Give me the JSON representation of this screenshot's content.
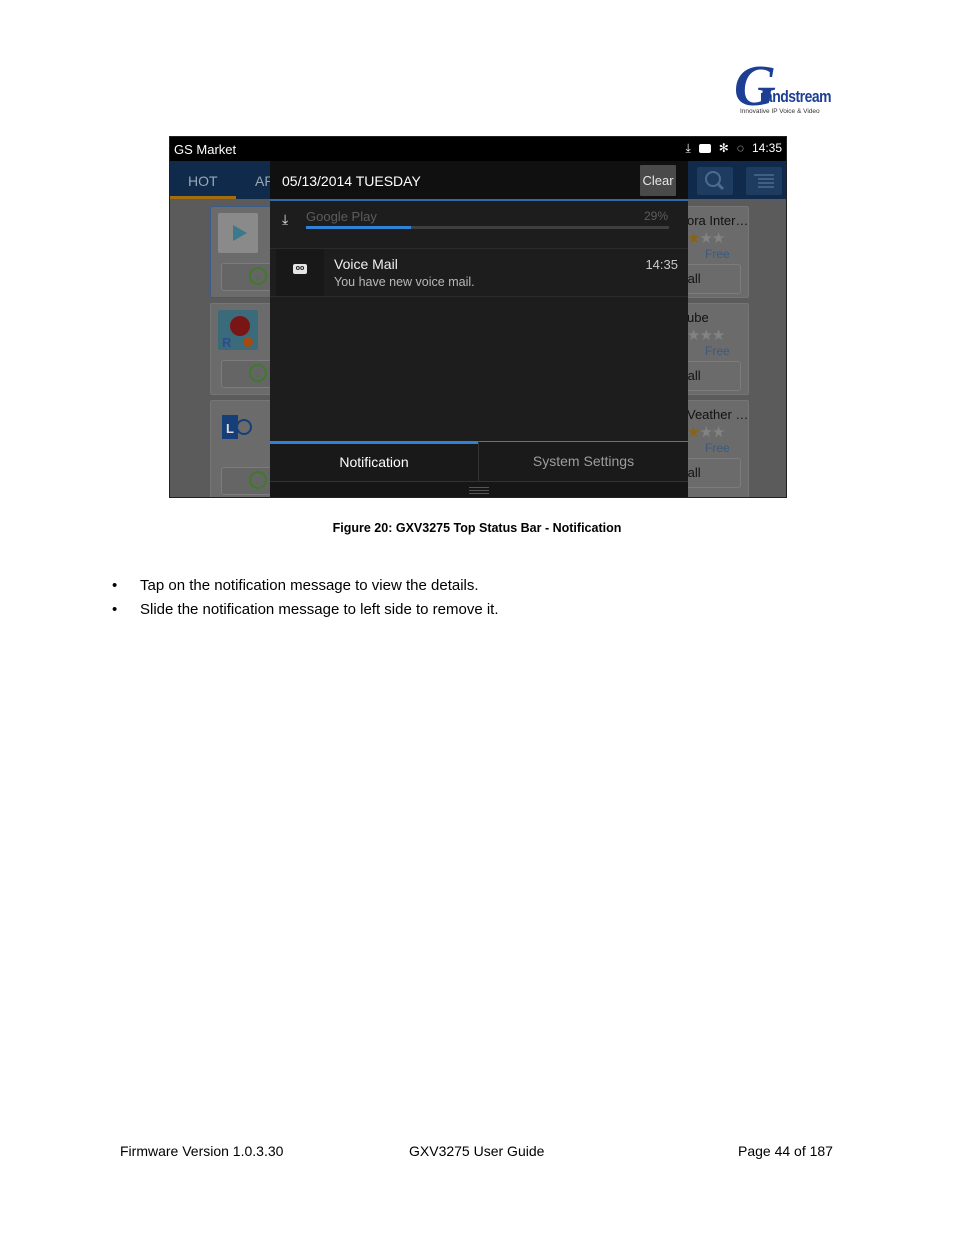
{
  "logo": {
    "brand_initial": "G",
    "brand_rest": "randstream",
    "tagline": "Innovative IP Voice & Video"
  },
  "screenshot": {
    "statusbar": {
      "app_name": "GS Market",
      "icons": [
        "download-icon",
        "voicemail-icon",
        "bluetooth-icon",
        "sync-icon"
      ],
      "time": "14:35"
    },
    "background_app": {
      "tabs": [
        "HOT",
        "AP"
      ],
      "right_cards": [
        {
          "title": "ora Inter…",
          "stars_filled": 1,
          "stars_total": 3,
          "price": "Free",
          "button": "tall"
        },
        {
          "title": "ube",
          "stars_filled": 0,
          "stars_total": 3,
          "price": "Free",
          "button": "tall"
        },
        {
          "title": "Veather …",
          "stars_filled": 1,
          "stars_total": 3,
          "price": "Free",
          "button": "tall"
        }
      ]
    },
    "panel": {
      "date": "05/13/2014 TUESDAY",
      "clear_label": "Clear",
      "notifications": [
        {
          "type": "download",
          "title": "Google Play",
          "progress_percent": "29%",
          "progress": 0.29
        },
        {
          "type": "voicemail",
          "title": "Voice Mail",
          "time": "14:35",
          "message": "You have new voice mail."
        }
      ],
      "tabs": [
        {
          "label": "Notification",
          "active": true
        },
        {
          "label": "System Settings",
          "active": false
        }
      ]
    },
    "colors": {
      "accent_blue": "#2f82d6",
      "tab_underline_orange": "#a46d0e"
    }
  },
  "caption": "Figure 20: GXV3275 Top Status Bar - Notification",
  "bullets": [
    "Tap on the notification message to view the details.",
    "Slide the notification message to left side to remove it."
  ],
  "footer": {
    "left": "Firmware Version 1.0.3.30",
    "center": "GXV3275 User Guide",
    "right": "Page 44 of 187"
  }
}
